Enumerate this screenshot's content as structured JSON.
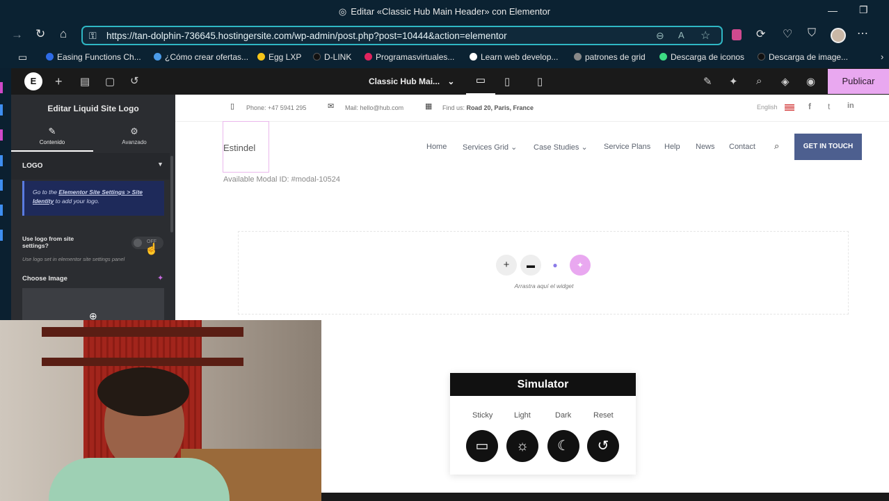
{
  "window": {
    "title": "Editar «Classic Hub Main Header» con Elementor"
  },
  "browser": {
    "url": "https://tan-dolphin-736645.hostingersite.com/wp-admin/post.php?post=10444&action=elementor"
  },
  "bookmarks": [
    {
      "label": "Easing Functions Ch...",
      "color": "#2e6be6"
    },
    {
      "label": "¿Cómo crear ofertas...",
      "color": "#4b9be8"
    },
    {
      "label": "Egg LXP",
      "color": "#f5c518"
    },
    {
      "label": "D-LINK",
      "color": "#111111"
    },
    {
      "label": "Programasvirtuales...",
      "color": "#e0245e"
    },
    {
      "label": "Learn web develop...",
      "color": "#ffffff"
    },
    {
      "label": "patrones de grid",
      "color": "#888888"
    },
    {
      "label": "Descarga de iconos",
      "color": "#3ddc84"
    },
    {
      "label": "Descarga de image...",
      "color": "#111111"
    }
  ],
  "editor": {
    "document_title": "Classic Hub Mai...",
    "publish_label": "Publicar",
    "panel": {
      "title": "Editar Liquid Site Logo",
      "tabs": [
        {
          "label": "Contenido",
          "icon": "pencil-icon"
        },
        {
          "label": "Avanzado",
          "icon": "gear-icon"
        }
      ],
      "section_title": "LOGO",
      "notice_prefix": "Go to the ",
      "notice_link": "Elementor Site Settings > Site Identity",
      "notice_suffix": " to add your logo.",
      "toggle_label": "Use logo from site settings?",
      "toggle_state": "OFF",
      "toggle_hint": "Use logo set in elementor site settings panel",
      "choose_image_label": "Choose Image"
    }
  },
  "site": {
    "topbar": {
      "phone": "Phone: +47 5941 295",
      "mail": "Mail: hello@hub.com",
      "find_prefix": "Find us: ",
      "find_address": "Road 20, Paris, France",
      "language": "English"
    },
    "logo_alt": "Estindel",
    "modal_text": "Available Modal ID: #modal-10524",
    "nav": [
      "Home",
      "Services Grid",
      "Case Studies",
      "Service Plans",
      "Help",
      "News",
      "Contact"
    ],
    "cta": "GET IN TOUCH",
    "dropzone_hint": "Arrastra aquí el widget",
    "simulator": {
      "title": "Simulator",
      "buttons": [
        "Sticky",
        "Light",
        "Dark",
        "Reset"
      ]
    }
  },
  "colors": {
    "accent": "#e9a8f0",
    "cta_bg": "#4d5f8f",
    "panel_bg": "#2b2d31",
    "notice_bg": "#1e2a5a",
    "url_border": "#2fb7c4"
  }
}
